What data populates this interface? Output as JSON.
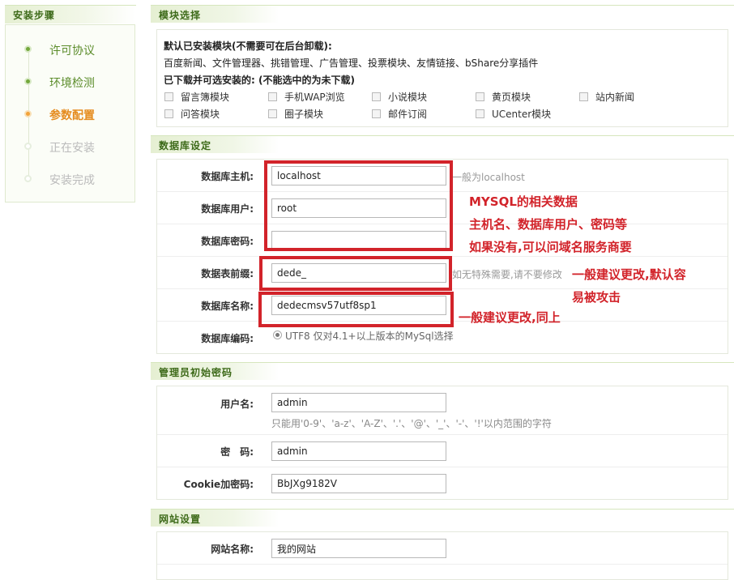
{
  "steps": {
    "title": "安装步骤",
    "items": [
      {
        "label": "许可协议",
        "state": "done"
      },
      {
        "label": "环境检测",
        "state": "done"
      },
      {
        "label": "参数配置",
        "state": "current"
      },
      {
        "label": "正在安装",
        "state": "pending"
      },
      {
        "label": "安装完成",
        "state": "pending"
      }
    ]
  },
  "modules": {
    "title": "模块选择",
    "installed_heading": "默认已安装模块(不需要可在后台卸载):",
    "installed_list": "百度新闻、文件管理器、挑错管理、广告管理、投票模块、友情链接、bShare分享插件",
    "optional_heading": "已下载并可选安装的: (不能选中的为未下载)",
    "optional": [
      "留言簿模块",
      "手机WAP浏览",
      "小说模块",
      "黄页模块",
      "站内新闻",
      "问答模块",
      "圈子模块",
      "邮件订阅",
      "UCenter模块"
    ]
  },
  "database": {
    "title": "数据库设定",
    "host_label": "数据库主机:",
    "host_value": "localhost",
    "host_hint": "一般为localhost",
    "user_label": "数据库用户:",
    "user_value": "root",
    "password_label": "数据库密码:",
    "password_value": "",
    "prefix_label": "数据表前缀:",
    "prefix_value": "dede_",
    "prefix_hint": "如无特殊需要,请不要修改",
    "name_label": "数据库名称:",
    "name_value": "dedecmsv57utf8sp1",
    "charset_label": "数据库编码:",
    "charset_option": "UTF8 仅对4.1+以上版本的MySql选择"
  },
  "admin": {
    "title": "管理员初始密码",
    "username_label": "用户名:",
    "username_value": "admin",
    "username_hint": "只能用'0-9'、'a-z'、'A-Z'、'.'、'@'、'_'、'-'、'!'以内范围的字符",
    "password_label": "密　码:",
    "password_value": "admin",
    "cookie_label": "Cookie加密码:",
    "cookie_value": "BbJXg9182V"
  },
  "site": {
    "title": "网站设置",
    "name_label": "网站名称:",
    "name_value": "我的网站"
  },
  "annotations": {
    "mysql_1": "MYSQL的相关数据",
    "mysql_2": "主机名、数据库用户、密码等",
    "mysql_3": "如果没有,可以问域名服务商要",
    "prefix_1": "一般建议更改,默认容",
    "prefix_2": "易被攻击",
    "dbname": "一般建议更改,同上"
  },
  "colors": {
    "accent_green": "#3d6a19",
    "step_done": "#73a83c",
    "step_current": "#f2a33a",
    "annotation_red": "#d2232a"
  }
}
